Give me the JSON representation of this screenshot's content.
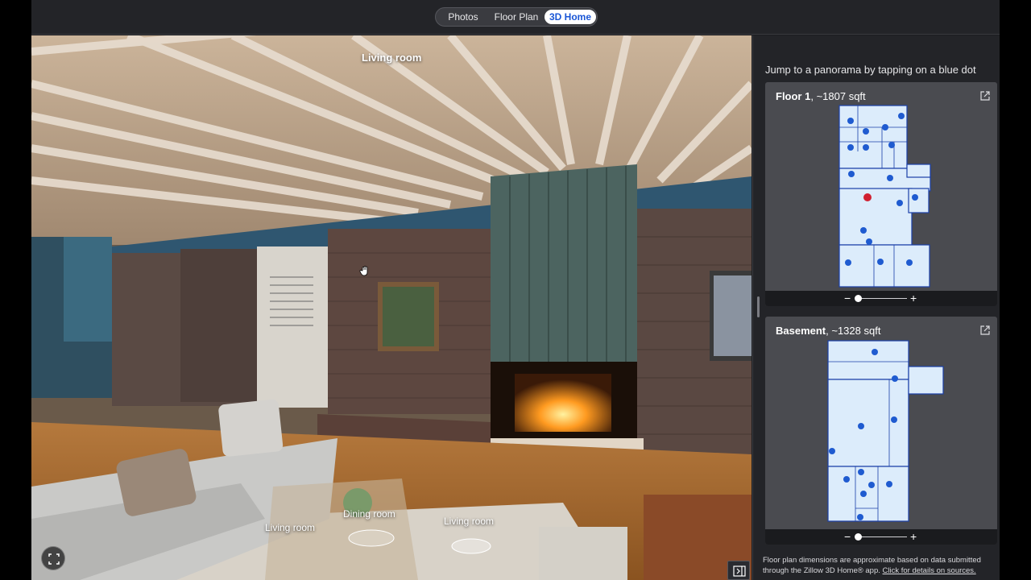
{
  "tabs": [
    {
      "label": "Photos",
      "active": false
    },
    {
      "label": "Floor Plan",
      "active": false
    },
    {
      "label": "3D Home",
      "active": true
    }
  ],
  "viewer": {
    "room_title": "Living room",
    "hotspots": [
      {
        "label": "Dining room"
      },
      {
        "label": "Living room"
      },
      {
        "label": "Living room"
      }
    ],
    "icons": [
      "fullscreen-icon",
      "collapse-panel-icon",
      "hand-cursor-icon"
    ]
  },
  "panel": {
    "instruction": "Jump to a panorama by tapping on a blue dot",
    "floors": [
      {
        "name": "Floor 1",
        "area": ", ~1807 sqft"
      },
      {
        "name": "Basement",
        "area": ", ~1328 sqft"
      }
    ],
    "zoom_minus": "−",
    "zoom_plus": "+",
    "footnote_text": "Floor plan dimensions are approximate based on data submitted through the Zillow 3D Home® app. ",
    "footnote_link": "Click for details on sources."
  },
  "colors": {
    "accent": "#1a56d6",
    "dot": "#1f5bd0",
    "current_dot": "#d02030",
    "plan_fill": "#dcecfb"
  }
}
